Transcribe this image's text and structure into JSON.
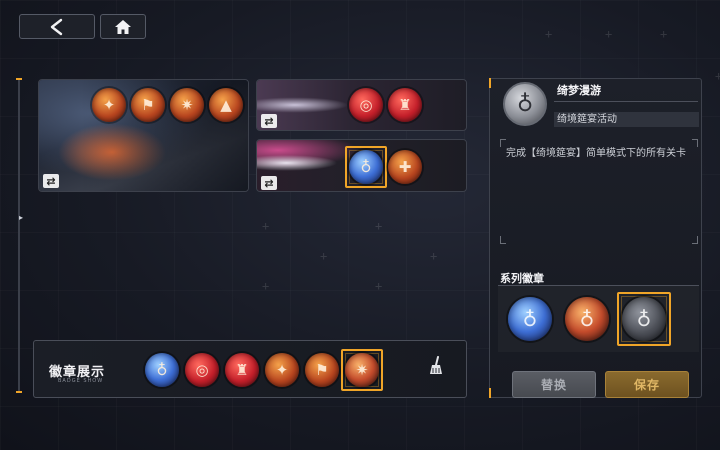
{
  "nav": {
    "back_icon": "chevron-left-icon",
    "home_icon": "home-icon"
  },
  "cards": [
    {
      "id": "card-1",
      "badges": [
        {
          "color": "orange",
          "icon": "emblem-icon"
        },
        {
          "color": "orange",
          "icon": "emblem-icon"
        },
        {
          "color": "orange",
          "icon": "emblem-icon"
        },
        {
          "color": "orange",
          "icon": "emblem-icon"
        }
      ]
    },
    {
      "id": "card-2",
      "badges": [
        {
          "color": "red",
          "icon": "emblem-icon"
        },
        {
          "color": "red",
          "icon": "emblem-icon"
        }
      ]
    },
    {
      "id": "card-3",
      "badges": [
        {
          "color": "blue",
          "icon": "planet-icon",
          "selected": true
        },
        {
          "color": "orange",
          "icon": "emblem-icon"
        }
      ]
    }
  ],
  "showcase": {
    "title": "徽章展示",
    "subtitle": "BADGE SHOW",
    "slots": [
      "blue",
      "red",
      "red",
      "orange",
      "orange",
      "ember"
    ],
    "selected_slot": 5,
    "clear_icon": "broom-icon"
  },
  "detail": {
    "name": "绮梦漫游",
    "tag": "绮境筵宴活动",
    "description": "完成【绮境筵宴】简单模式下的所有关卡",
    "series_title": "系列徽章",
    "series": [
      "blue",
      "ember",
      "gray"
    ],
    "series_selected": 2
  },
  "buttons": {
    "replace_label": "替换",
    "save_label": "保存"
  },
  "colors": {
    "accent": "#f0a528",
    "panel": "#1d2029",
    "save_text": "#e0b765"
  }
}
